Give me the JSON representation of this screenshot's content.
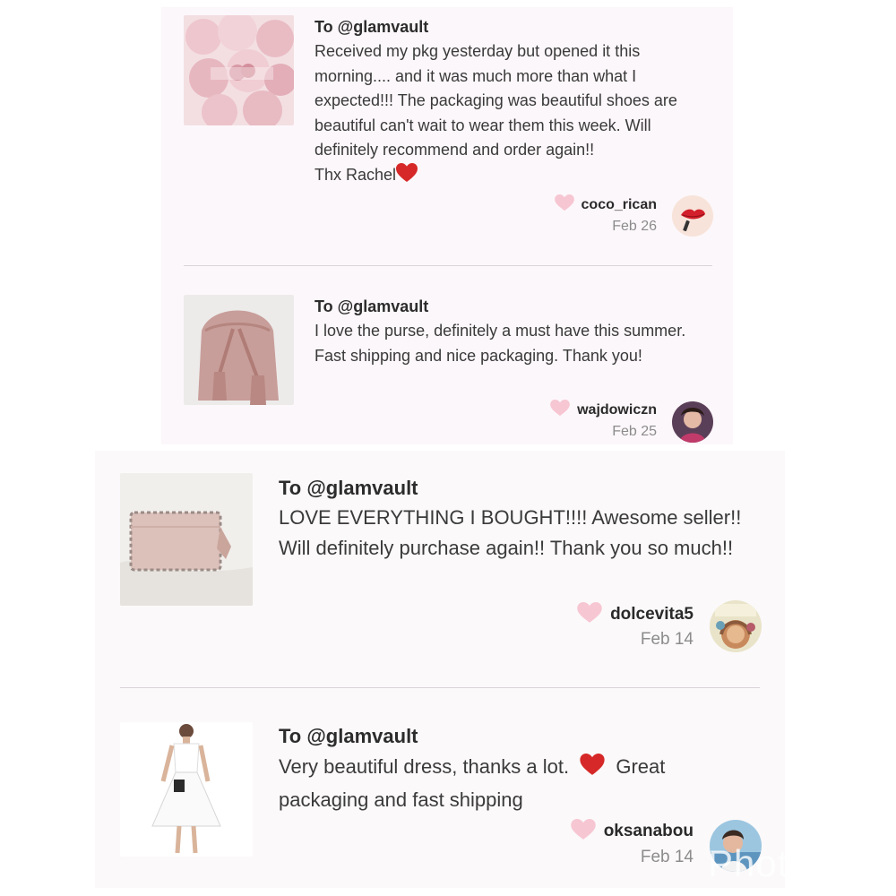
{
  "reviews": [
    {
      "to": "To @glamvault",
      "body": "Received my pkg yesterday but opened it this morning.... and it was much more than what I expected!!! The packaging was beautiful shoes are beautiful can't wait to wear them this week. Will definitely recommend and order again!!",
      "closing": "Thx Rachel",
      "username": "coco_rican",
      "date": "Feb 26",
      "thumb_text": "coco_rican"
    },
    {
      "to": "To @glamvault",
      "body": "I love the purse, definitely a must have this summer. Fast shipping and nice packaging. Thank you!",
      "username": "wajdowiczn",
      "date": "Feb 25"
    },
    {
      "to": "To @glamvault",
      "body": "LOVE EVERYTHING I BOUGHT!!!! Awesome seller!! Will definitely purchase again!! Thank you so much!!",
      "username": "dolcevita5",
      "date": "Feb 14"
    },
    {
      "to": "To @glamvault",
      "body_before": "Very beautiful dress, thanks a lot.",
      "body_after": "Great packaging and fast shipping",
      "username": "oksanabou",
      "date": "Feb 14"
    }
  ],
  "watermark": "Phot",
  "colors": {
    "heart_red": "#d62828",
    "like_pink": "#f7c6d3",
    "date_gray": "#8c8c8c"
  },
  "icons": {
    "like": "heart-icon",
    "emoji": "red-heart-emoji"
  }
}
